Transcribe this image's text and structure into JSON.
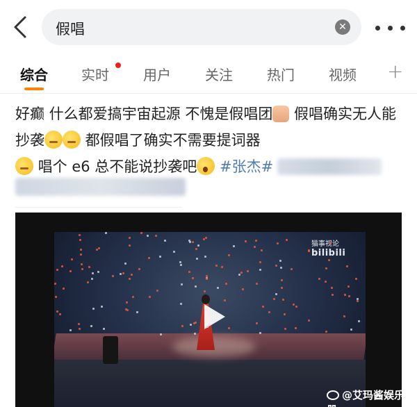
{
  "search": {
    "query": "假唱"
  },
  "tabs": [
    {
      "label": "综合",
      "active": true
    },
    {
      "label": "实时",
      "badge": true
    },
    {
      "label": "用户"
    },
    {
      "label": "关注"
    },
    {
      "label": "热门"
    },
    {
      "label": "视频"
    }
  ],
  "post": {
    "seg1": "好癫 什么都爱搞宇宙起源 不愧是假唱团",
    "seg2": " 假唱确实无人能抄袭",
    "seg3": " 都假唱了确实不需要提词器",
    "seg4": " 唱个 e6 总不能说抄袭吧",
    "hashtag": "#张杰#"
  },
  "video": {
    "watermark": "bilibili",
    "watermark_prefix": "猫事视论"
  },
  "credit": "@艾玛酱娱乐手册",
  "colors": {
    "accent": "#ff8200",
    "hashtag": "#507daf",
    "badge": "#e8231a"
  }
}
